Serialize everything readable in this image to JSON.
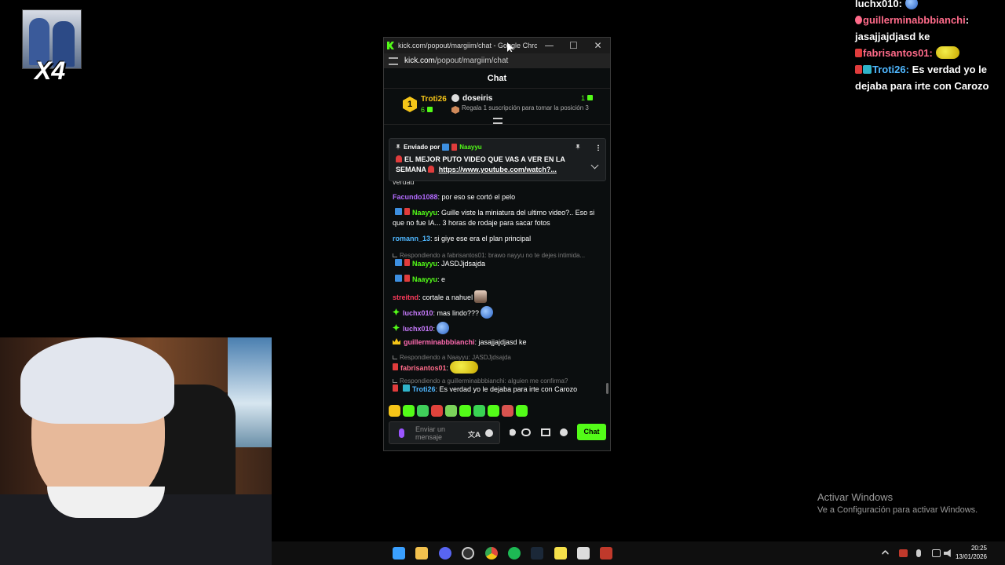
{
  "overlay_topleft": {
    "multiplier": "X4"
  },
  "overlay_chat": [
    {
      "user": "luchx010:",
      "text": "",
      "user_color": "#ffffff",
      "emote": "globe"
    },
    {
      "user": "guillerminabbbianchi",
      "text": ":",
      "user_color": "#ff6b8a",
      "badge": "heart"
    },
    {
      "user": "",
      "text": "jasajjajdjasd ke",
      "user_color": "#ffffff"
    },
    {
      "user": "fabrisantos01:",
      "text": "",
      "user_color": "#ff6b8a",
      "badge": "red",
      "emote": "pikachu"
    },
    {
      "user": "Troti26:",
      "text": " Es verdad yo le",
      "user_color": "#4fb7ff",
      "badge": "red-sub"
    },
    {
      "user": "",
      "text": "dejaba para irte con Carozo",
      "user_color": "#ffffff"
    }
  ],
  "window": {
    "title": "kick.com/popout/margiim/chat - Google Chrome",
    "url_host": "kick.com",
    "url_path": "/popout/margiim/chat",
    "minimize": "—",
    "maximize": "☐",
    "close": "✕"
  },
  "chat": {
    "header": "Chat",
    "leaderboard": {
      "rank": "1",
      "first_name": "Troti26",
      "first_count": "6",
      "second_name": "doseiris",
      "second_count": "1",
      "description": "Regala 1 suscripción para tomar la posición 3"
    },
    "pinned": {
      "sent_by_label": "Enviado por",
      "user": "Naayyu",
      "text": "EL MEJOR PUTO VIDEO QUE VAS A VER EN LA SEMANA",
      "link": "https://www.youtube.com/watch?..."
    },
    "messages": [
      {
        "user": "",
        "text": "verdad",
        "color": "#cccccc"
      },
      {
        "user": "Facundo1088",
        "text": ": por eso se cortó el pelo",
        "color": "#b36bff"
      },
      {
        "user": "Naayyu",
        "text": ": Guille viste la miniatura del ultimo video?.. Eso si que no fue IA... 3 horas de rodaje para sacar fotos",
        "color": "#53fc18"
      },
      {
        "user": "romann_13",
        "text": ": si giye ese era el plan principal",
        "color": "#4fb7ff"
      },
      {
        "reply": "Respondiendo a fabrisantos01: brawo nayyu no te dejes intimida..."
      },
      {
        "user": "Naayyu",
        "text": ": JASDJjdsajda",
        "color": "#53fc18"
      },
      {
        "user": "Naayyu",
        "text": ": e",
        "color": "#53fc18"
      },
      {
        "user": "streitnd",
        "text": ": cortale a nahuel",
        "color": "#ff3b5c"
      },
      {
        "user": "luchx010",
        "text": ": mas lindo???",
        "color": "#c97bff"
      },
      {
        "user": "luchx010",
        "text": ":",
        "color": "#c97bff"
      },
      {
        "user": "guillerminabbbianchi",
        "text": ": jasajjajdjasd ke",
        "color": "#ff6bb0"
      },
      {
        "reply": "Respondiendo a Naayyu: JASDJjdsajda"
      },
      {
        "user": "fabrisantos01",
        "text": ":",
        "color": "#ff6b8a"
      },
      {
        "reply": "Respondiendo a guillerminabbbianchi: alguien me confirma?"
      },
      {
        "user": "Troti26",
        "text": ": Es verdad yo le dejaba para irte con Carozo",
        "color": "#4fb7ff"
      }
    ],
    "input_placeholder": "Enviar un mensaje",
    "send_label": "Chat",
    "translate_glyph": "文A"
  },
  "desktop": {
    "activate_title": "Activar Windows",
    "activate_sub": "Ve a Configuración para activar Windows.",
    "clock_time": "20:25",
    "clock_date": "13/01/2026"
  },
  "colors": {
    "kick_green": "#53fc18",
    "gold": "#f5c518"
  },
  "icons": [
    "windows-start-icon",
    "file-explorer-icon",
    "discord-icon",
    "obs-icon",
    "chrome-icon",
    "spotify-icon",
    "steam-icon",
    "sticky-notes-icon",
    "app-icon",
    "voicemeeter-icon"
  ]
}
